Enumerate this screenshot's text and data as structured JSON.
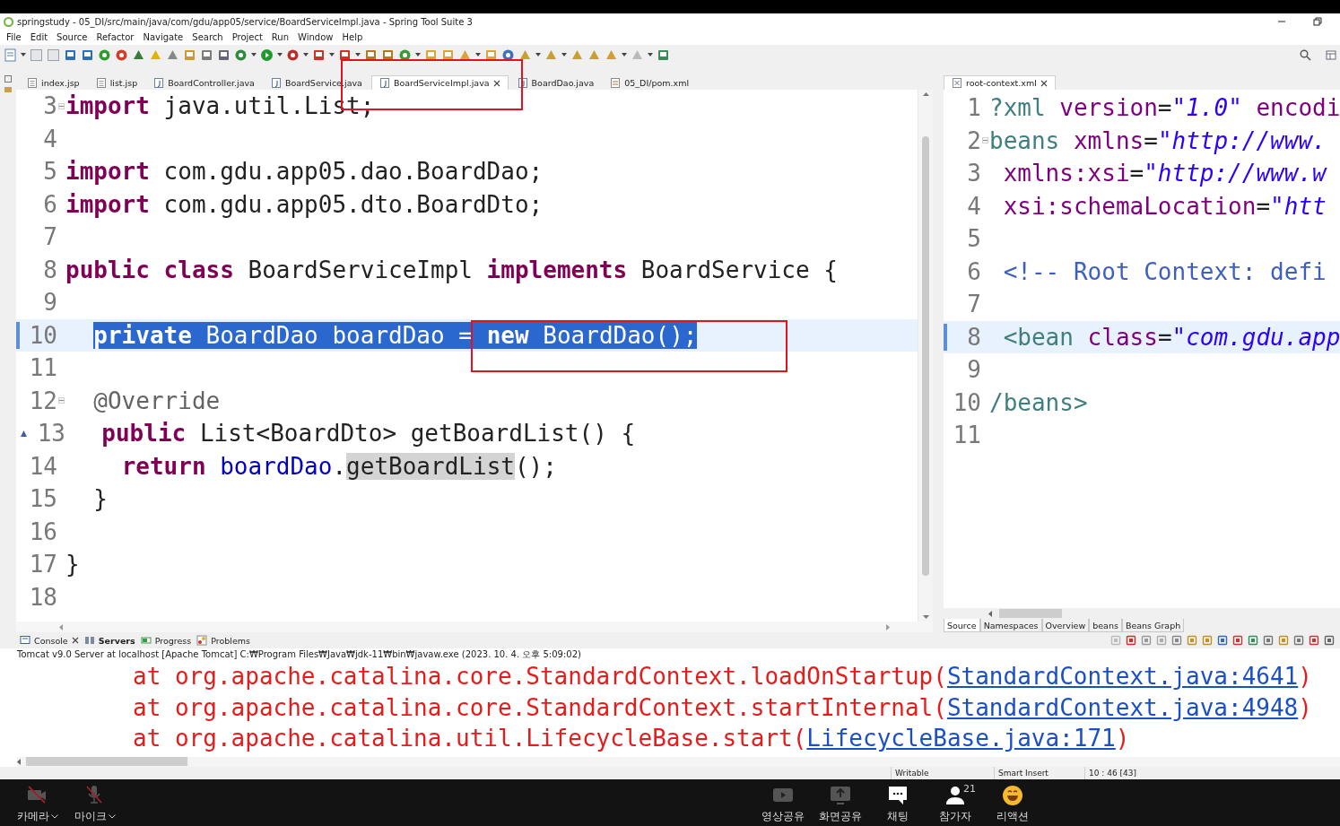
{
  "window": {
    "title": "springstudy - 05_DI/src/main/java/com/gdu/app05/service/BoardServiceImpl.java - Spring Tool Suite 3"
  },
  "menu": [
    "File",
    "Edit",
    "Source",
    "Refactor",
    "Navigate",
    "Search",
    "Project",
    "Run",
    "Window",
    "Help"
  ],
  "editor_tabs": [
    {
      "label": "index.jsp",
      "kind": "page",
      "selected": false
    },
    {
      "label": "list.jsp",
      "kind": "page",
      "selected": false
    },
    {
      "label": "BoardController.java",
      "kind": "java",
      "selected": false
    },
    {
      "label": "BoardService.java",
      "kind": "java",
      "selected": false
    },
    {
      "label": "BoardServiceImpl.java",
      "kind": "java",
      "selected": true
    },
    {
      "label": "BoardDao.java",
      "kind": "java",
      "selected": false
    },
    {
      "label": "05_DI/pom.xml",
      "kind": "pom",
      "selected": false
    }
  ],
  "editor": {
    "lines": [
      {
        "number": "3",
        "fold": true,
        "override": false,
        "current": false,
        "tokens": [
          {
            "kw": "import"
          },
          {
            "pl": " java.util.List;"
          }
        ]
      },
      {
        "number": "4",
        "fold": false,
        "override": false,
        "current": false
      },
      {
        "number": "5",
        "fold": false,
        "override": false,
        "current": false,
        "tokens": [
          {
            "kw": "import"
          },
          {
            "pl": " com.gdu.app05.dao.BoardDao;"
          }
        ]
      },
      {
        "number": "6",
        "fold": false,
        "override": false,
        "current": false,
        "tokens": [
          {
            "kw": "import"
          },
          {
            "pl": " com.gdu.app05.dto.BoardDto;"
          }
        ]
      },
      {
        "number": "7",
        "fold": false,
        "override": false,
        "current": false
      },
      {
        "number": "8",
        "fold": false,
        "override": false,
        "current": false,
        "tokens": [
          {
            "kw": "public class"
          },
          {
            "pl": " BoardServiceImpl "
          },
          {
            "kw": "implements"
          },
          {
            "pl": " BoardService {"
          }
        ]
      },
      {
        "number": "9",
        "fold": false,
        "override": false,
        "current": false
      },
      {
        "number": "10",
        "fold": false,
        "override": false,
        "current": true,
        "selected": true,
        "tokens": [
          {
            "kw": "  private"
          },
          {
            "pl": " BoardDao "
          },
          {
            "fld": "boardDao"
          },
          {
            "pl": " = "
          },
          {
            "kw": "new"
          },
          {
            "pl": " BoardDao();"
          }
        ]
      },
      {
        "number": "11",
        "fold": false,
        "override": false,
        "current": false
      },
      {
        "number": "12",
        "fold": true,
        "override": false,
        "current": false,
        "tokens": [
          {
            "ann": "  @Override"
          }
        ]
      },
      {
        "number": "13",
        "fold": false,
        "override": true,
        "current": false,
        "tokens": [
          {
            "kw": "  public"
          },
          {
            "pl": " List<BoardDto> getBoardList() {"
          }
        ]
      },
      {
        "number": "14",
        "fold": false,
        "override": false,
        "current": false,
        "tokens": [
          {
            "kw": "    return"
          },
          {
            "fld": " boardDao"
          },
          {
            "pl": "."
          },
          {
            "occ": "getBoardList"
          },
          {
            "pl": "();"
          }
        ]
      },
      {
        "number": "15",
        "fold": false,
        "override": false,
        "current": false,
        "tokens": [
          {
            "pl": "  }"
          }
        ]
      },
      {
        "number": "16",
        "fold": false,
        "override": false,
        "current": false
      },
      {
        "number": "17",
        "fold": false,
        "override": false,
        "current": false,
        "tokens": [
          {
            "pl": "}"
          }
        ]
      },
      {
        "number": "18",
        "fold": false,
        "override": false,
        "current": false
      }
    ]
  },
  "xml_tabs": [
    {
      "label": "root-context.xml",
      "selected": true
    }
  ],
  "xml_editor": {
    "lines": [
      {
        "number": "1",
        "fold": false,
        "current": false,
        "tokens": [
          {
            "tag": "?xml"
          },
          {
            "attr": " version"
          },
          {
            "pl": "="
          },
          {
            "str": "\"1.0\""
          },
          {
            "attr": " encodi"
          }
        ]
      },
      {
        "number": "2",
        "fold": true,
        "current": false,
        "tokens": [
          {
            "tag": "beans"
          },
          {
            "attr": " xmlns"
          },
          {
            "pl": "="
          },
          {
            "str": "\"http://www."
          }
        ]
      },
      {
        "number": "3",
        "fold": false,
        "current": false,
        "tokens": [
          {
            "attr": " xmlns:xsi"
          },
          {
            "pl": "="
          },
          {
            "str": "\"http://www.w"
          }
        ]
      },
      {
        "number": "4",
        "fold": false,
        "current": false,
        "tokens": [
          {
            "attr": " xsi:schemaLocation"
          },
          {
            "pl": "="
          },
          {
            "str": "\"htt"
          }
        ]
      },
      {
        "number": "5",
        "fold": false,
        "current": false
      },
      {
        "number": "6",
        "fold": false,
        "current": false,
        "tokens": [
          {
            "com": " <!-- Root Context: defi"
          }
        ]
      },
      {
        "number": "7",
        "fold": false,
        "current": false
      },
      {
        "number": "8",
        "fold": false,
        "current": true,
        "tokens": [
          {
            "tag": " <bean"
          },
          {
            "attr": " class"
          },
          {
            "pl": "="
          },
          {
            "str": "\"com.gdu.app"
          }
        ]
      },
      {
        "number": "9",
        "fold": false,
        "current": false
      },
      {
        "number": "10",
        "fold": false,
        "current": false,
        "tokens": [
          {
            "tag": "/beans>"
          }
        ]
      },
      {
        "number": "11",
        "fold": false,
        "current": false
      }
    ]
  },
  "xml_page_tabs": [
    {
      "label": "Source",
      "selected": true
    },
    {
      "label": "Namespaces",
      "selected": false
    },
    {
      "label": "Overview",
      "selected": false
    },
    {
      "label": "beans",
      "selected": false
    },
    {
      "label": "Beans Graph",
      "selected": false
    }
  ],
  "console_tabs": [
    {
      "label": "Console",
      "kind": "console",
      "selected": true,
      "changed": false
    },
    {
      "label": "Servers",
      "kind": "servers",
      "selected": false,
      "changed": true
    },
    {
      "label": "Progress",
      "kind": "progress",
      "selected": false,
      "changed": false
    },
    {
      "label": "Problems",
      "kind": "problems",
      "selected": false,
      "changed": false
    }
  ],
  "console": {
    "header": "Tomcat v9.0 Server at localhost [Apache Tomcat] C:₩Program Files₩Java₩jdk-11₩bin₩javaw.exe  (2023. 10. 4. 오후 5:09:02)",
    "lines": [
      {
        "text": "at org.apache.catalina.core.StandardContext.loadOnStartup(",
        "link": "StandardContext.java:4641",
        "end": ")"
      },
      {
        "text": "at org.apache.catalina.core.StandardContext.startInternal(",
        "link": "StandardContext.java:4948",
        "end": ")"
      },
      {
        "text": "at org.apache.catalina.util.LifecycleBase.start(",
        "link": "LifecycleBase.java:171",
        "end": ")"
      }
    ]
  },
  "status_bar": [
    "Writable",
    "Smart Insert",
    "10 : 46 [43]"
  ],
  "meeting_bar": {
    "left": [
      {
        "label": "카메라",
        "kind": "camera"
      },
      {
        "label": "마이크",
        "kind": "mic"
      }
    ],
    "center": [
      {
        "label": "영상공유",
        "kind": "video"
      },
      {
        "label": "화면공유",
        "kind": "screen"
      },
      {
        "label": "채팅",
        "kind": "chat"
      },
      {
        "label": "참가자",
        "kind": "people",
        "count": "21"
      },
      {
        "label": "리액션",
        "kind": "reaction"
      }
    ]
  }
}
